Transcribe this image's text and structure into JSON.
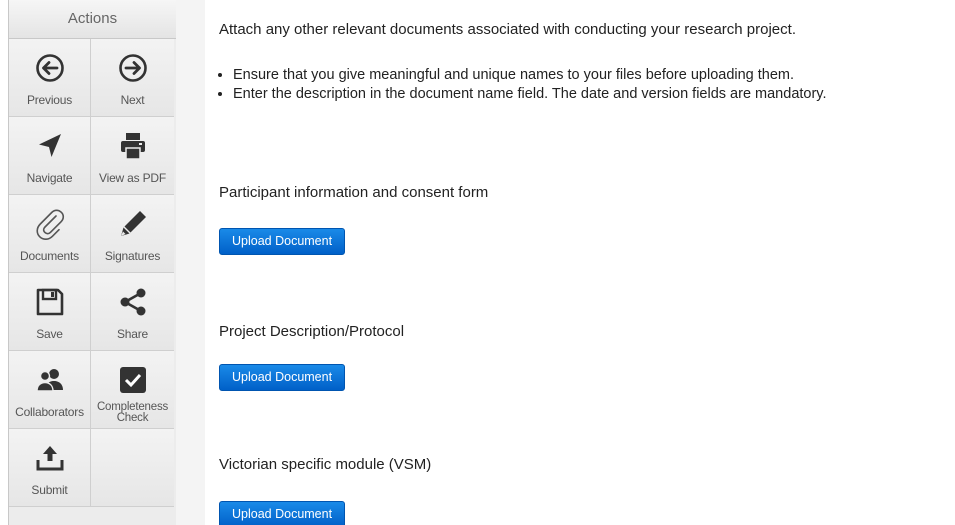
{
  "sidebar": {
    "header": "Actions",
    "items": [
      {
        "label": "Previous",
        "icon": "arrow-left-circle-icon"
      },
      {
        "label": "Next",
        "icon": "arrow-right-circle-icon"
      },
      {
        "label": "Navigate",
        "icon": "navigation-arrow-icon"
      },
      {
        "label": "View as PDF",
        "icon": "printer-icon"
      },
      {
        "label": "Documents",
        "icon": "paperclip-icon"
      },
      {
        "label": "Signatures",
        "icon": "pencil-icon"
      },
      {
        "label": "Save",
        "icon": "floppy-disk-icon"
      },
      {
        "label": "Share",
        "icon": "share-icon"
      },
      {
        "label": "Collaborators",
        "icon": "users-icon"
      },
      {
        "label": "Completeness\nCheck",
        "icon": "checkbox-icon"
      },
      {
        "label": "Submit",
        "icon": "upload-tray-icon"
      }
    ]
  },
  "main": {
    "intro": "Attach any other relevant documents associated with conducting your research project.",
    "bullets": [
      "Ensure that you give meaningful and unique names to your files before uploading them.",
      "Enter the description in the document name field. The date and version fields are mandatory."
    ],
    "sections": [
      {
        "title": "Participant information and consent form",
        "button_label": "Upload Document"
      },
      {
        "title": "Project Description/Protocol",
        "button_label": "Upload Document"
      },
      {
        "title": "Victorian specific module (VSM)",
        "button_label": "Upload Document"
      }
    ]
  },
  "colors": {
    "button_blue": "#0a74da",
    "sidebar_bg": "#ececec",
    "icon_dark": "#333333"
  }
}
